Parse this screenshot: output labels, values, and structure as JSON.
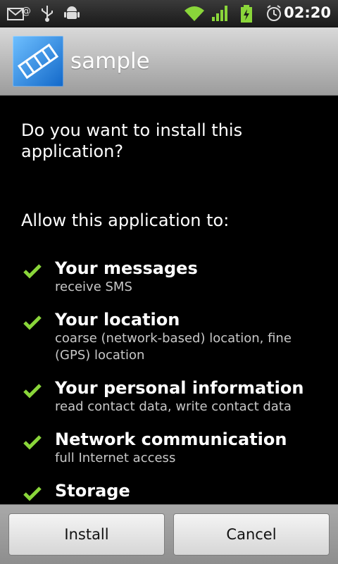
{
  "status_bar": {
    "time": "02:20",
    "icons": [
      "mail-icon",
      "usb-icon",
      "android-debug-icon",
      "wifi-icon",
      "signal-icon",
      "battery-charging-icon",
      "alarm-icon"
    ]
  },
  "header": {
    "app_name": "sample",
    "app_icon": "filmstrip-icon"
  },
  "content": {
    "question": "Do you want to install this application?",
    "allow_heading": "Allow this application to:",
    "permissions": [
      {
        "title": "Your messages",
        "description": "receive SMS"
      },
      {
        "title": "Your location",
        "description": "coarse (network-based) location, fine (GPS) location"
      },
      {
        "title": "Your personal information",
        "description": "read contact data, write contact data"
      },
      {
        "title": "Network communication",
        "description": "full Internet access"
      },
      {
        "title": "Storage",
        "description": ""
      }
    ]
  },
  "buttons": {
    "install": "Install",
    "cancel": "Cancel"
  },
  "colors": {
    "check": "#8ad63a",
    "signal": "#8ad63a"
  }
}
